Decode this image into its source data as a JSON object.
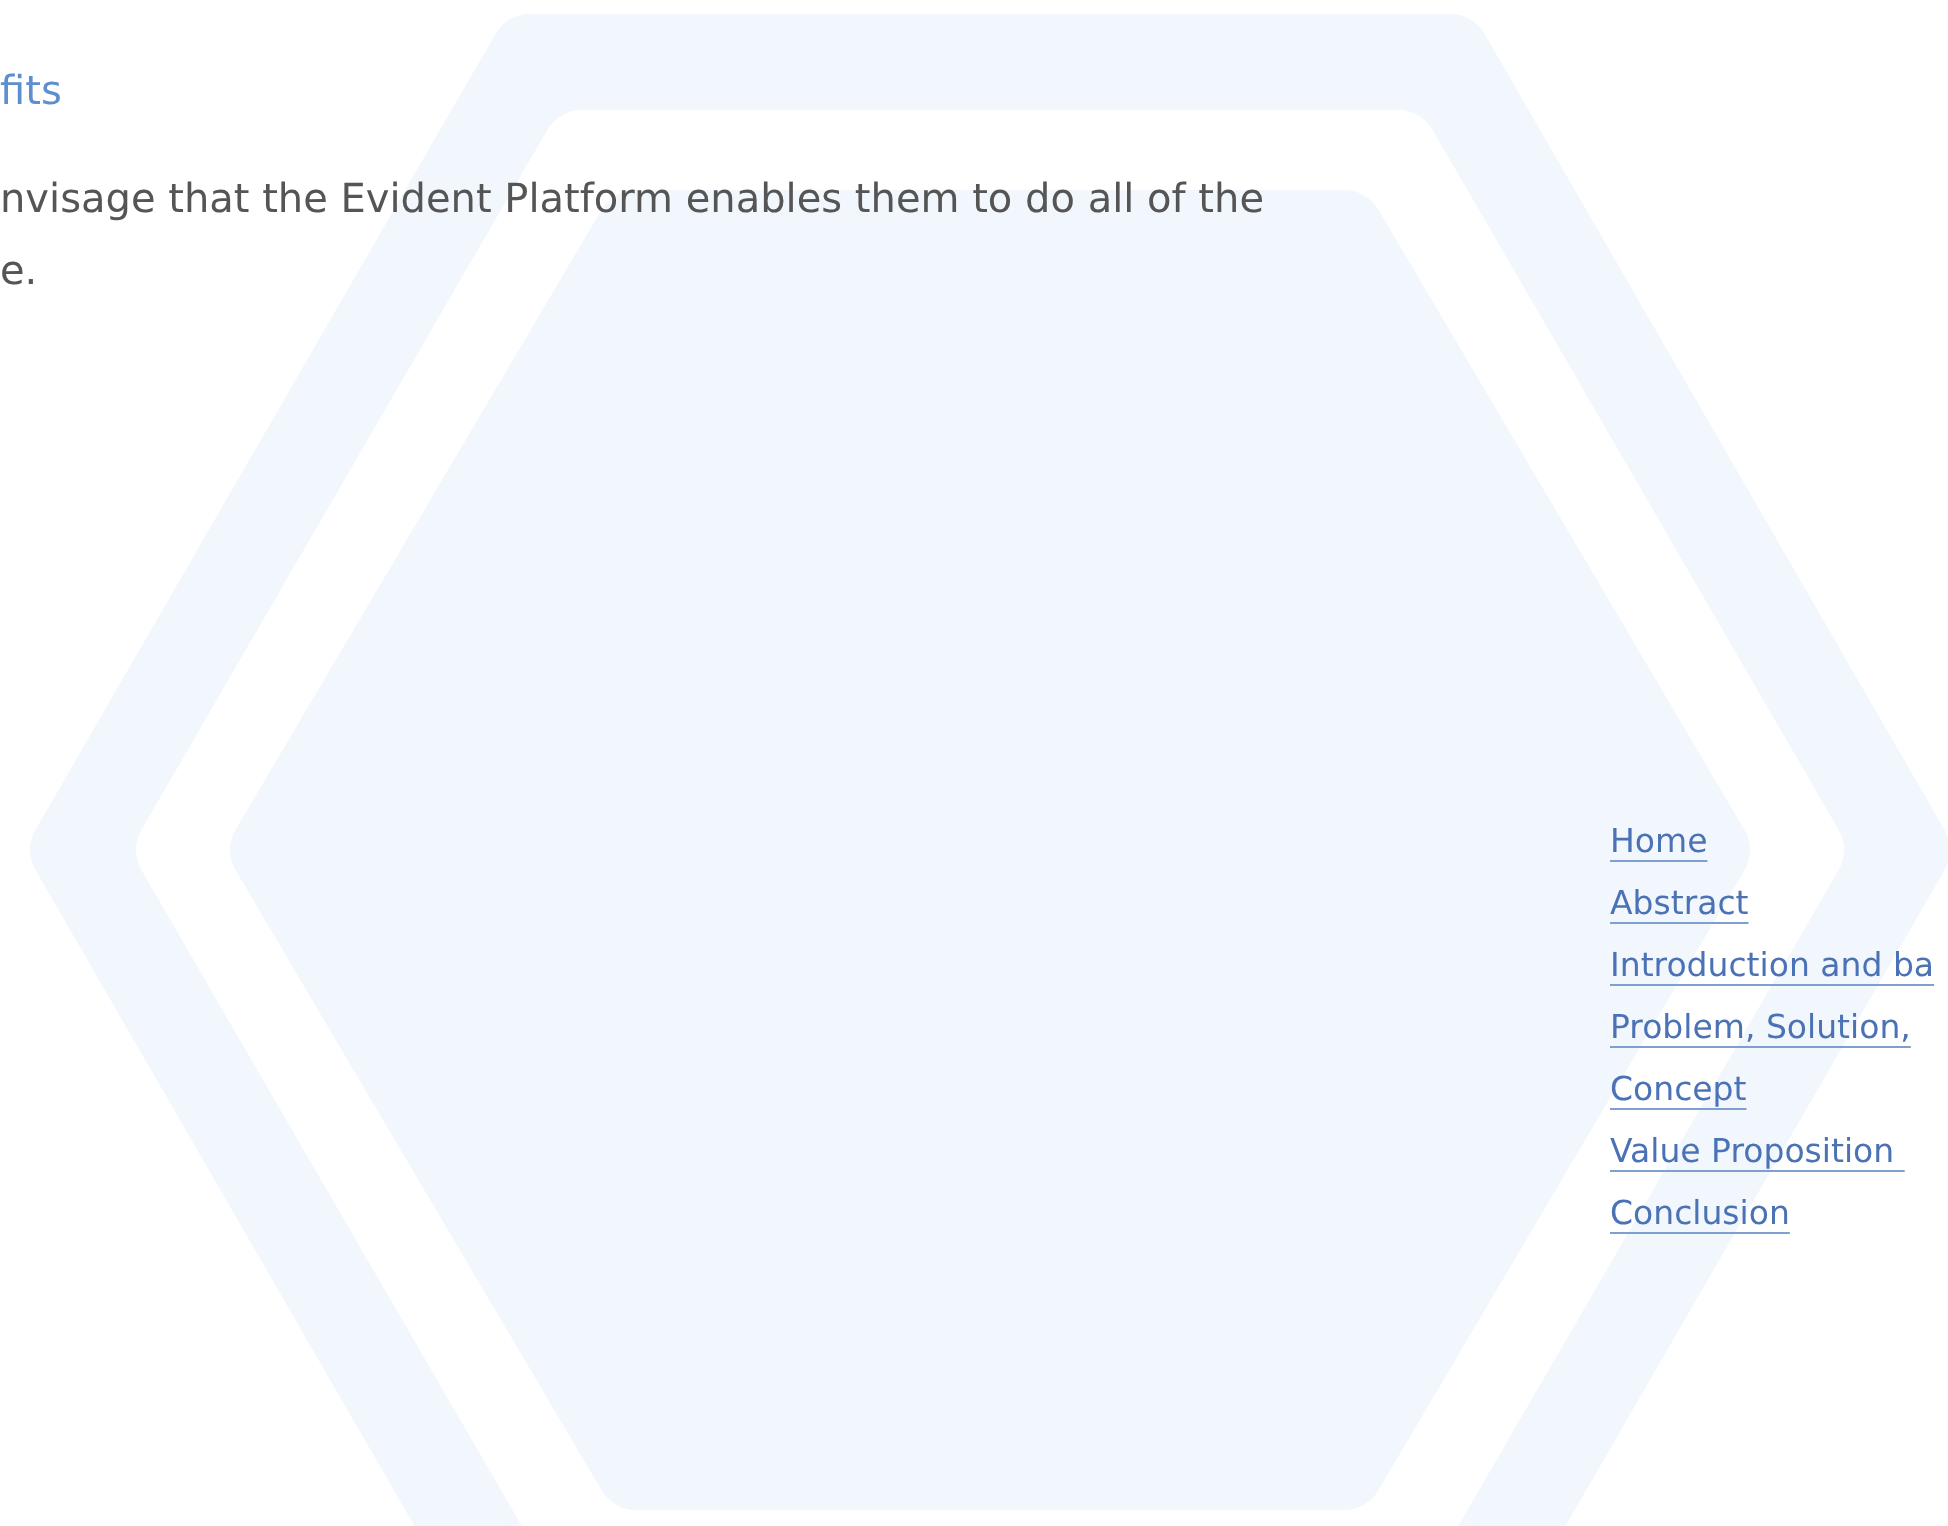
{
  "heading": "fits",
  "paragraph": "nvisage that the Evident Platform enables them to do all of the\ne.",
  "nav_links": [
    {
      "label": "Home"
    },
    {
      "label": "Abstract"
    },
    {
      "label": "Introduction and ba"
    },
    {
      "label": "Problem, Solution,"
    },
    {
      "label": "Concept"
    },
    {
      "label": "Value Proposition "
    },
    {
      "label": "Conclusion"
    }
  ]
}
